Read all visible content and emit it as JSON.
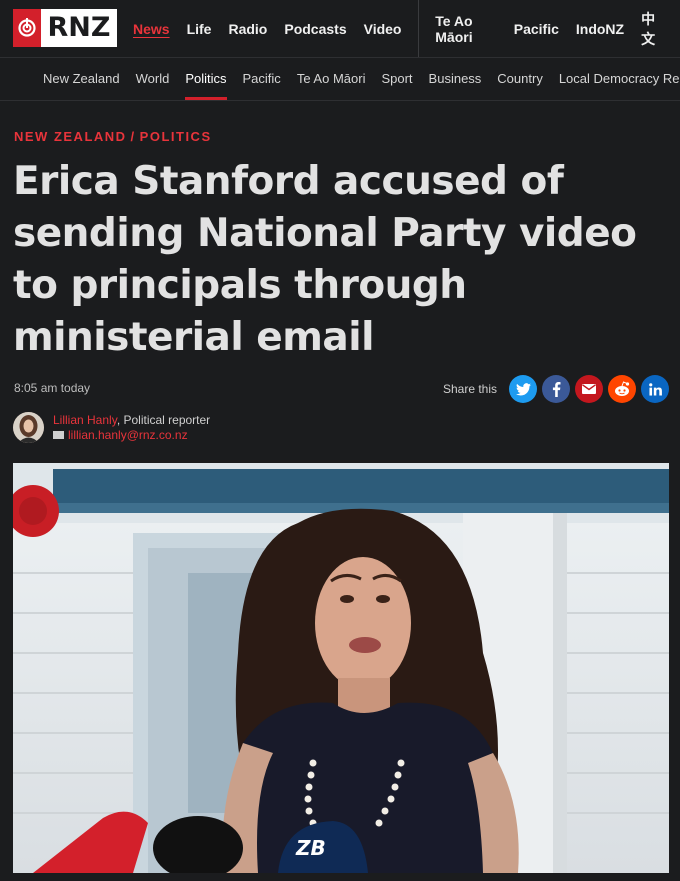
{
  "brand": {
    "logo_text": "RNZ"
  },
  "top_nav": {
    "primary": [
      "News",
      "Life",
      "Radio",
      "Podcasts",
      "Video"
    ],
    "secondary": [
      "Te Ao Māori",
      "Pacific",
      "IndoNZ",
      "中文"
    ],
    "active": "News"
  },
  "section_nav": {
    "items": [
      "New Zealand",
      "World",
      "Politics",
      "Pacific",
      "Te Ao Māori",
      "Sport",
      "Business",
      "Country",
      "Local Democracy Rep"
    ],
    "active": "Politics"
  },
  "article": {
    "kicker_1": "NEW ZEALAND",
    "kicker_sep": "/",
    "kicker_2": "POLITICS",
    "headline": "Erica Stanford accused of sending National Party video to principals through ministerial email",
    "time": "8:05 am today",
    "share_label": "Share this",
    "author_name": "Lillian Hanly",
    "author_role": ", Political reporter",
    "author_email": "lillian.hanly@rnz.co.nz"
  },
  "share_buttons": [
    {
      "icon": "twitter-icon",
      "color": "#1d9bf0"
    },
    {
      "icon": "facebook-icon",
      "color": "#3b5998"
    },
    {
      "icon": "email-icon",
      "color": "#c4171e"
    },
    {
      "icon": "reddit-icon",
      "color": "#ff4500"
    },
    {
      "icon": "linkedin-icon",
      "color": "#0a66c2"
    }
  ],
  "colors": {
    "accent": "#e8343b",
    "background": "#1b1c1e",
    "brand_red": "#d3202b"
  }
}
